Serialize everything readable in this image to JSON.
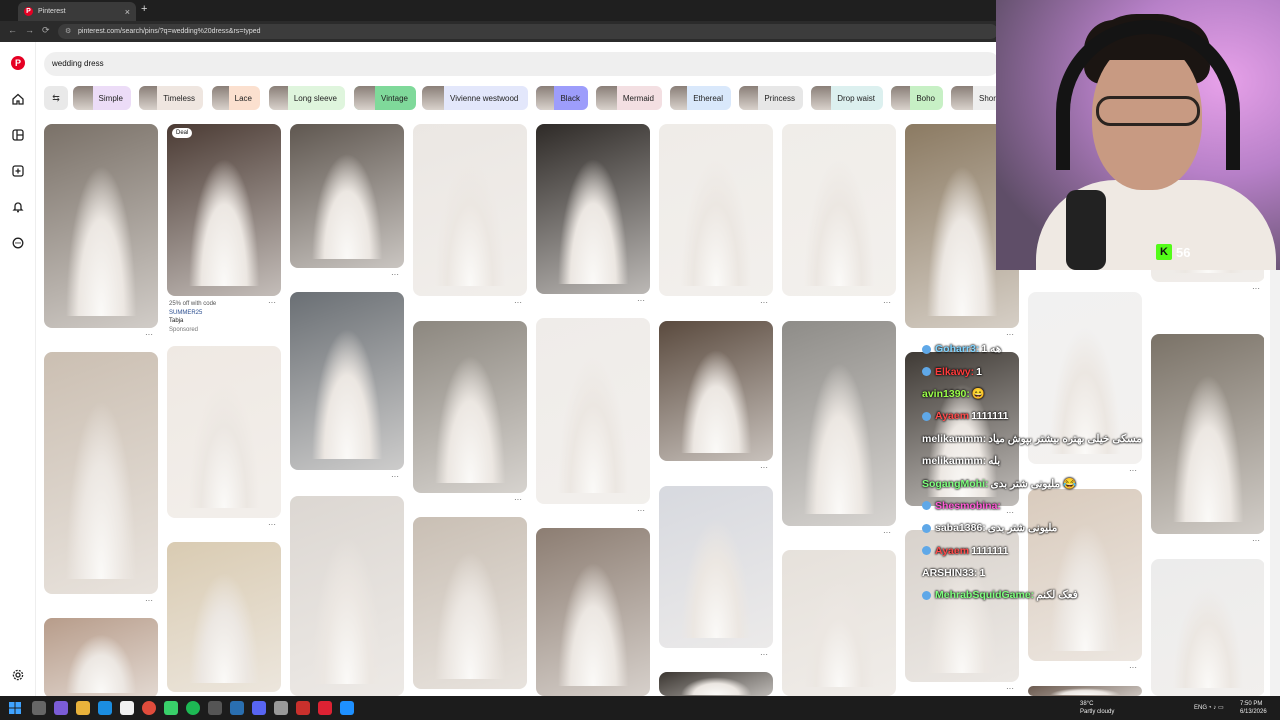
{
  "browser": {
    "tab_title": "Pinterest",
    "tab_favicon": "P",
    "tab_close": "×",
    "new_tab": "+",
    "url": "pinterest.com/search/pins/?q=wedding%20dress&rs=typed",
    "back": "←",
    "forward": "→",
    "reload": "⟳",
    "lock": "⚙"
  },
  "rail": {
    "logo": "P",
    "icons": [
      "home-icon",
      "explore-icon",
      "create-icon",
      "notifications-icon",
      "messages-icon",
      "settings-icon"
    ]
  },
  "search": {
    "value": "wedding dress"
  },
  "filter_icon": "⇆",
  "chips": [
    {
      "label": "Simple",
      "bg": "#ecdcf7"
    },
    {
      "label": "Timeless",
      "bg": "#efe6e0"
    },
    {
      "label": "Lace",
      "bg": "#fbe0cf"
    },
    {
      "label": "Long sleeve",
      "bg": "#dff5dd"
    },
    {
      "label": "Vintage",
      "bg": "#7fd99a"
    },
    {
      "label": "Vivienne westwood",
      "bg": "#e3e7fb"
    },
    {
      "label": "Black",
      "bg": "#9d9dfb"
    },
    {
      "label": "Mermaid",
      "bg": "#f3dfe2"
    },
    {
      "label": "Ethereal",
      "bg": "#d9e8fb"
    },
    {
      "label": "Princess",
      "bg": "#e7e7e7"
    },
    {
      "label": "Drop waist",
      "bg": "#dcf0ef"
    },
    {
      "label": "Boho",
      "bg": "#c7f0c5"
    },
    {
      "label": "Shor",
      "bg": "#eeeeee"
    }
  ],
  "pins": {
    "deal_badge": "Deal",
    "more": "···",
    "promo": {
      "line1": "25% off with code",
      "line2": "SUMMER25",
      "line3": "Tabja",
      "line4": "Sponsored"
    }
  },
  "stream": {
    "viewer_count": "56",
    "kick_logo": "K"
  },
  "chat": [
    {
      "user": "Goharr3:",
      "text": "1 هه",
      "color": "#7fd4ff",
      "badge": true
    },
    {
      "user": "Elkawy:",
      "text": "1",
      "color": "#ff3b3b",
      "badge": true
    },
    {
      "user": "avin1390:",
      "text": "😄",
      "color": "#9bff4a",
      "badge": false
    },
    {
      "user": "Ayaem",
      "text": "1111111",
      "color": "#ff4b4b",
      "badge": true
    },
    {
      "user": "melikammm:",
      "text": "مسکی خیلی بهتره بیشتر بپوش میاد",
      "color": "#ffffff",
      "badge": false
    },
    {
      "user": "melikammm:",
      "text": "بله",
      "color": "#ffffff",
      "badge": false
    },
    {
      "user": "SogangMohi:",
      "text": "ملیونی شتر بدی 😂",
      "color": "#7fff7f",
      "badge": false
    },
    {
      "user": "Shesmobina:",
      "text": "",
      "color": "#ff5bd6",
      "badge": true
    },
    {
      "user": "saba1386:",
      "text": "ملیونی شتر بدی",
      "color": "#ffffff",
      "badge": true
    },
    {
      "user": "Ayaem",
      "text": "1111111",
      "color": "#ff4b4b",
      "badge": true
    },
    {
      "user": "ARSHIN33:",
      "text": "1",
      "color": "#ffffff",
      "badge": false
    },
    {
      "user": "MehrabSquidGame:",
      "text": "فعک لکنم",
      "color": "#7fff7f",
      "badge": true
    }
  ],
  "taskbar": {
    "weather_temp": "38°C",
    "weather_desc": "Partly cloudy",
    "lang": "ENG",
    "time": "7:50 PM",
    "date": "6/13/2026"
  }
}
